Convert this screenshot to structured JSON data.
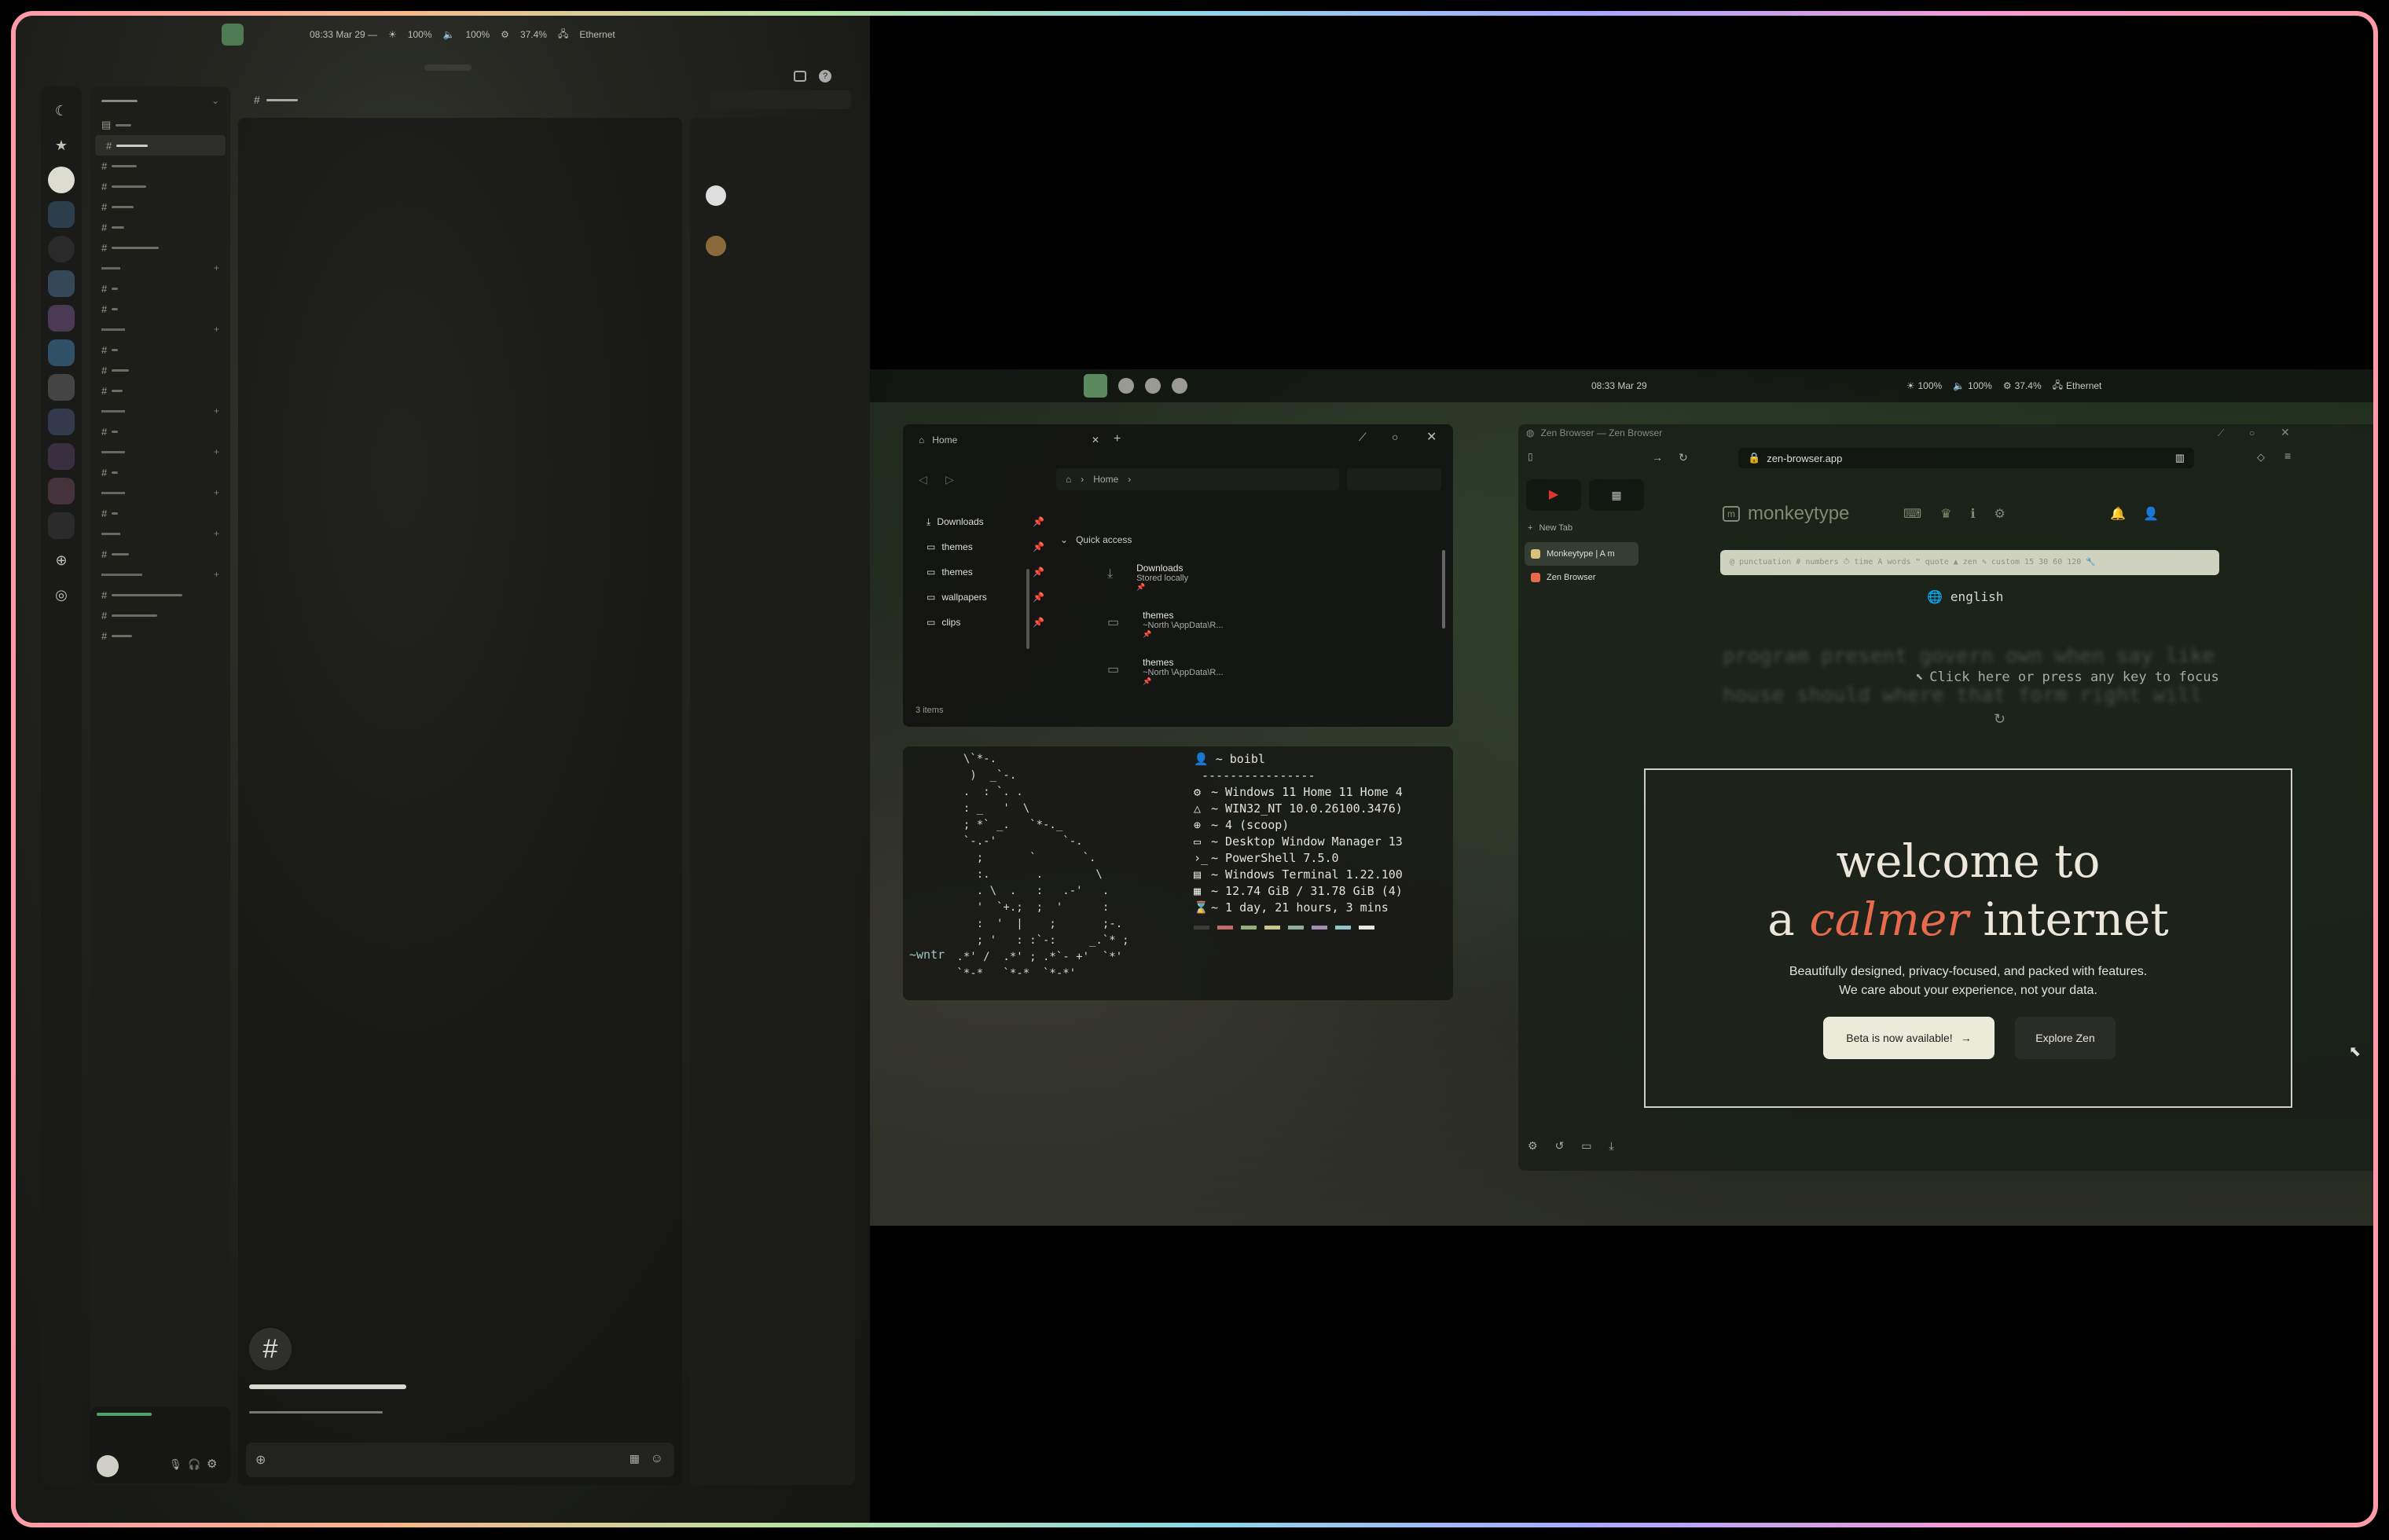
{
  "left_client": {
    "status_bar": {
      "time": "08:33 Mar 29 —",
      "brightness": "100%",
      "volume": "100%",
      "cpu": "37.4%",
      "network": "Ethernet"
    }
  },
  "desktop": {
    "status_bar": {
      "time": "08:33 Mar 29",
      "brightness": "100%",
      "volume": "100%",
      "cpu": "37.4%",
      "network": "Ethernet"
    }
  },
  "file_explorer": {
    "tab_title": "Home",
    "breadcrumb": "Home",
    "sidebar": [
      {
        "label": "Downloads",
        "icon": "download-icon"
      },
      {
        "label": "themes",
        "icon": "folder-icon"
      },
      {
        "label": "themes",
        "icon": "folder-icon"
      },
      {
        "label": "wallpapers",
        "icon": "folder-icon"
      },
      {
        "label": "clips",
        "icon": "folder-icon"
      }
    ],
    "section": "Quick access",
    "items": [
      {
        "name": "Downloads",
        "sub": "Stored locally",
        "icon": "download-icon"
      },
      {
        "name": "themes",
        "sub": "~North \\AppData\\R...",
        "icon": "folder-icon"
      },
      {
        "name": "themes",
        "sub": "~North \\AppData\\R...",
        "icon": "folder-icon"
      }
    ],
    "status": "3 items"
  },
  "terminal": {
    "ascii": "  \\`*-.\n   )  _`-.\n  .  : `. .\n  : _   '  \\\n  ; *` _.   `*-._\n  `-.-'          `-.\n    ;       `       `.\n    :.       .        \\\n    . \\  .   :   .-'   .\n    '  `+.;  ;  '      :\n    :  '  |    ;       ;-.\n    ; '   : :`-:     _.`* ;\n .*' /  .*' ; .*`- +'  `*'\n `*-*   `*-*  `*-*'",
    "prompt": "~wntr",
    "user": "~ boibl",
    "separator": "----------------",
    "info": [
      {
        "icon": "gear-icon",
        "text": "~ Windows 11 Home 11 Home 4"
      },
      {
        "icon": "triangle-icon",
        "text": "~ WIN32_NT 10.0.26100.3476)"
      },
      {
        "icon": "box-icon",
        "text": "~ 4 (scoop)"
      },
      {
        "icon": "window-icon",
        "text": "~ Desktop Window Manager 13"
      },
      {
        "icon": "prompt-icon",
        "text": "~ PowerShell 7.5.0"
      },
      {
        "icon": "terminal-icon",
        "text": "~ Windows Terminal 1.22.100"
      },
      {
        "icon": "memory-icon",
        "text": "~ 12.74 GiB / 31.78 GiB (4)"
      },
      {
        "icon": "hourglass-icon",
        "text": "~ 1 day, 21 hours, 3 mins"
      }
    ],
    "palette": [
      "#3a3a36",
      "#c46a6a",
      "#8fb07a",
      "#c9c58a",
      "#8fae9a",
      "#a58fb5",
      "#8fc4c4",
      "#e8e8e0"
    ]
  },
  "zen_browser": {
    "window_title": "Zen Browser — Zen Browser",
    "url": "zen-browser.app",
    "new_tab": "New Tab",
    "tabs": [
      "Monkeytype | A m",
      "Zen Browser"
    ],
    "monkeytype": {
      "logo": "monkeytype",
      "config_bar": "@ punctuation  # numbers  ⏱ time  A words  ❝ quote  ▲ zen  ✎ custom   15  30  60  120  🔧",
      "language": "english",
      "words": "program present govern own when say like house should where that form right will",
      "focus_hint": "Click here or press any key to focus"
    },
    "hero": {
      "line1": "welcome to",
      "line2_a": "a",
      "line2_em": "calmer",
      "line2_b": "internet",
      "sub1": "Beautifully designed, privacy-focused, and packed with features.",
      "sub2": "We care about your experience, not your data.",
      "primary_button": "Beta is now available!",
      "secondary_button": "Explore Zen"
    },
    "accent": "#e86a4c"
  }
}
